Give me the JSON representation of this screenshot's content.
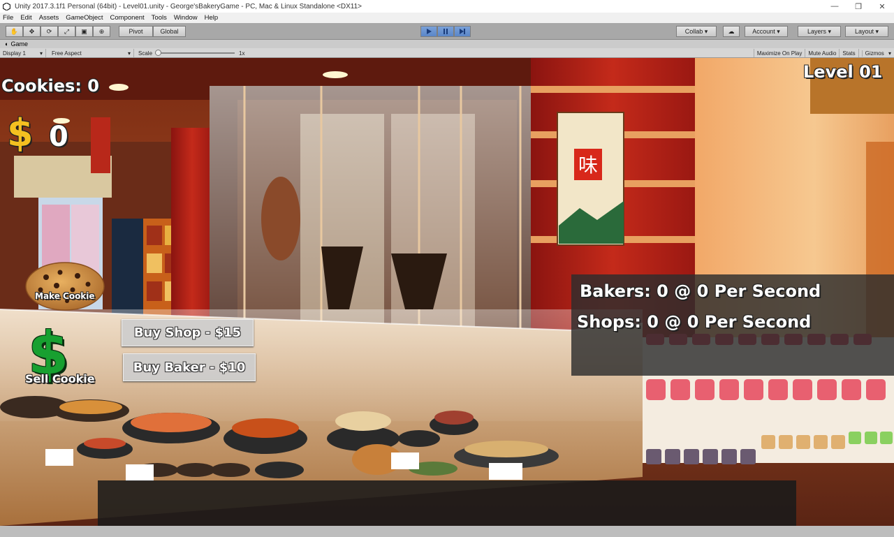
{
  "window": {
    "title": "Unity 2017.3.1f1 Personal (64bit) - Level01.unity - George'sBakeryGame - PC, Mac & Linux Standalone <DX11>"
  },
  "menu": [
    "File",
    "Edit",
    "Assets",
    "GameObject",
    "Component",
    "Tools",
    "Window",
    "Help"
  ],
  "toolbar": {
    "pivot": "Pivot",
    "global": "Global",
    "collab": "Collab ▾",
    "account": "Account",
    "layers": "Layers",
    "layout": "Layout"
  },
  "game_view": {
    "tab": "Game",
    "display": "Display 1",
    "aspect": "Free Aspect",
    "scale_label": "Scale",
    "scale_value": "1x",
    "maximize": "Maximize On Play",
    "mute": "Mute Audio",
    "stats": "Stats",
    "gizmos": "Gizmos"
  },
  "hud": {
    "cookies": "Cookies: 0",
    "money_symbol": "$",
    "money": "0",
    "level": "Level 01",
    "make_cookie": "Make Cookie",
    "sell_cookie": "Sell Cookie",
    "buy_shop": "Buy Shop - $15",
    "buy_baker": "Buy Baker - $10",
    "bakers": "Bakers: 0 @ 0 Per Second",
    "shops": "Shops: 0 @ 0 Per Second"
  },
  "scene": {
    "sign_glyph": "味"
  }
}
